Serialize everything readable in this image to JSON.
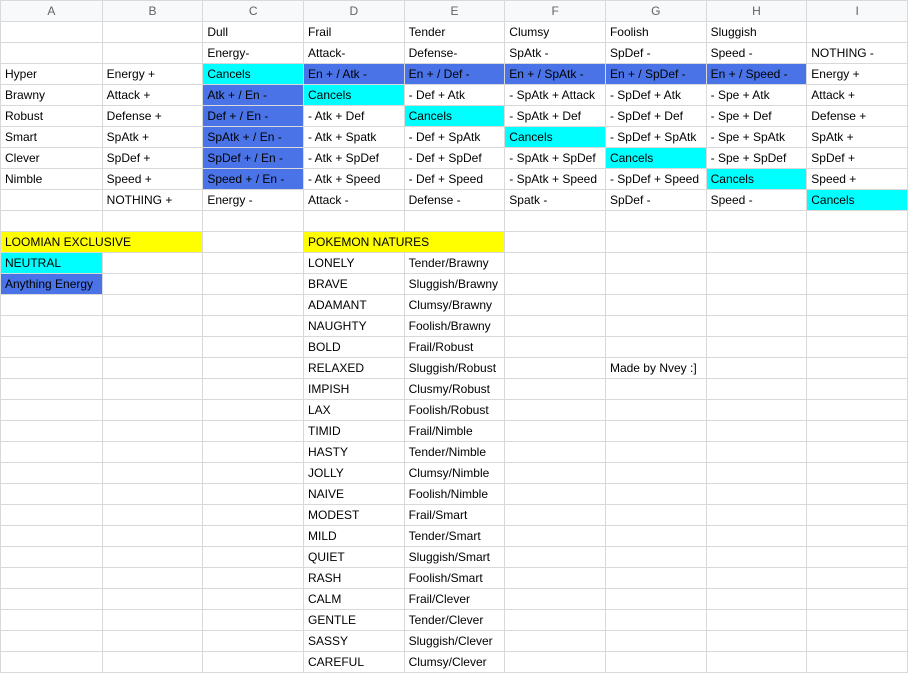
{
  "cols": [
    "A",
    "B",
    "C",
    "D",
    "E",
    "F",
    "G",
    "H",
    "I"
  ],
  "rows": [
    [
      {
        "t": ""
      },
      {
        "t": ""
      },
      {
        "t": "Dull"
      },
      {
        "t": "Frail"
      },
      {
        "t": "Tender"
      },
      {
        "t": "Clumsy"
      },
      {
        "t": "Foolish"
      },
      {
        "t": "Sluggish"
      },
      {
        "t": ""
      }
    ],
    [
      {
        "t": ""
      },
      {
        "t": ""
      },
      {
        "t": "Energy-"
      },
      {
        "t": "Attack-"
      },
      {
        "t": "Defense-"
      },
      {
        "t": "SpAtk -"
      },
      {
        "t": "SpDef -"
      },
      {
        "t": "Speed -"
      },
      {
        "t": "NOTHING -"
      }
    ],
    [
      {
        "t": "Hyper"
      },
      {
        "t": "Energy +"
      },
      {
        "t": "Cancels",
        "c": "cyan"
      },
      {
        "t": "En + / Atk -",
        "c": "blue"
      },
      {
        "t": "En + / Def -",
        "c": "blue"
      },
      {
        "t": "En + / SpAtk -",
        "c": "blue"
      },
      {
        "t": "En + / SpDef -",
        "c": "blue"
      },
      {
        "t": "En + / Speed -",
        "c": "blue"
      },
      {
        "t": "Energy +"
      }
    ],
    [
      {
        "t": "Brawny"
      },
      {
        "t": "Attack +"
      },
      {
        "t": "Atk + / En -",
        "c": "blue"
      },
      {
        "t": "Cancels",
        "c": "cyan"
      },
      {
        "t": "- Def + Atk"
      },
      {
        "t": "- SpAtk + Attack"
      },
      {
        "t": "- SpDef + Atk"
      },
      {
        "t": "- Spe + Atk"
      },
      {
        "t": "Attack +"
      }
    ],
    [
      {
        "t": "Robust"
      },
      {
        "t": "Defense +"
      },
      {
        "t": "Def + / En -",
        "c": "blue"
      },
      {
        "t": "- Atk + Def"
      },
      {
        "t": "Cancels",
        "c": "cyan"
      },
      {
        "t": "- SpAtk + Def"
      },
      {
        "t": "- SpDef + Def"
      },
      {
        "t": "- Spe + Def"
      },
      {
        "t": "Defense +"
      }
    ],
    [
      {
        "t": "Smart"
      },
      {
        "t": "SpAtk +"
      },
      {
        "t": "SpAtk + / En -",
        "c": "blue"
      },
      {
        "t": "- Atk + Spatk"
      },
      {
        "t": "- Def + SpAtk"
      },
      {
        "t": "Cancels",
        "c": "cyan"
      },
      {
        "t": "- SpDef + SpAtk"
      },
      {
        "t": "- Spe + SpAtk"
      },
      {
        "t": "SpAtk +"
      }
    ],
    [
      {
        "t": "Clever"
      },
      {
        "t": "SpDef +"
      },
      {
        "t": "SpDef + / En -",
        "c": "blue"
      },
      {
        "t": "- Atk + SpDef"
      },
      {
        "t": "- Def + SpDef"
      },
      {
        "t": "- SpAtk + SpDef"
      },
      {
        "t": "Cancels",
        "c": "cyan"
      },
      {
        "t": "- Spe + SpDef"
      },
      {
        "t": "SpDef +"
      }
    ],
    [
      {
        "t": "Nimble"
      },
      {
        "t": "Speed +"
      },
      {
        "t": "Speed + / En -",
        "c": "blue"
      },
      {
        "t": "- Atk + Speed"
      },
      {
        "t": "- Def + Speed"
      },
      {
        "t": "- SpAtk + Speed"
      },
      {
        "t": "- SpDef + Speed"
      },
      {
        "t": "Cancels",
        "c": "cyan"
      },
      {
        "t": "Speed +"
      }
    ],
    [
      {
        "t": ""
      },
      {
        "t": "NOTHING +"
      },
      {
        "t": "Energy -"
      },
      {
        "t": "Attack -"
      },
      {
        "t": "Defense -"
      },
      {
        "t": "Spatk -"
      },
      {
        "t": "SpDef -"
      },
      {
        "t": "Speed -"
      },
      {
        "t": "Cancels",
        "c": "cyan"
      }
    ],
    [
      {
        "t": ""
      },
      {
        "t": ""
      },
      {
        "t": ""
      },
      {
        "t": ""
      },
      {
        "t": ""
      },
      {
        "t": ""
      },
      {
        "t": ""
      },
      {
        "t": ""
      },
      {
        "t": ""
      }
    ],
    [
      {
        "t": "LOOMIAN EXCLUSIVE",
        "c": "yellow",
        "span": 2
      },
      {
        "t": ""
      },
      {
        "t": "POKEMON NATURES",
        "c": "yellow",
        "span": 2
      },
      {
        "t": ""
      },
      {
        "t": ""
      },
      {
        "t": ""
      },
      {
        "t": ""
      }
    ],
    [
      {
        "t": "NEUTRAL",
        "c": "cyan"
      },
      {
        "t": ""
      },
      {
        "t": ""
      },
      {
        "t": "LONELY"
      },
      {
        "t": "Tender/Brawny"
      },
      {
        "t": ""
      },
      {
        "t": ""
      },
      {
        "t": ""
      },
      {
        "t": ""
      }
    ],
    [
      {
        "t": "Anything Energy",
        "c": "blue"
      },
      {
        "t": ""
      },
      {
        "t": ""
      },
      {
        "t": "BRAVE"
      },
      {
        "t": "Sluggish/Brawny"
      },
      {
        "t": ""
      },
      {
        "t": ""
      },
      {
        "t": ""
      },
      {
        "t": ""
      }
    ],
    [
      {
        "t": ""
      },
      {
        "t": ""
      },
      {
        "t": ""
      },
      {
        "t": "ADAMANT"
      },
      {
        "t": "Clumsy/Brawny"
      },
      {
        "t": ""
      },
      {
        "t": ""
      },
      {
        "t": ""
      },
      {
        "t": ""
      }
    ],
    [
      {
        "t": ""
      },
      {
        "t": ""
      },
      {
        "t": ""
      },
      {
        "t": "NAUGHTY"
      },
      {
        "t": "Foolish/Brawny"
      },
      {
        "t": ""
      },
      {
        "t": ""
      },
      {
        "t": ""
      },
      {
        "t": ""
      }
    ],
    [
      {
        "t": ""
      },
      {
        "t": ""
      },
      {
        "t": ""
      },
      {
        "t": "BOLD"
      },
      {
        "t": "Frail/Robust"
      },
      {
        "t": ""
      },
      {
        "t": ""
      },
      {
        "t": ""
      },
      {
        "t": ""
      }
    ],
    [
      {
        "t": ""
      },
      {
        "t": ""
      },
      {
        "t": ""
      },
      {
        "t": "RELAXED"
      },
      {
        "t": "Sluggish/Robust"
      },
      {
        "t": ""
      },
      {
        "t": "Made by Nvey :]"
      },
      {
        "t": ""
      },
      {
        "t": ""
      }
    ],
    [
      {
        "t": ""
      },
      {
        "t": ""
      },
      {
        "t": ""
      },
      {
        "t": "IMPISH"
      },
      {
        "t": "Clusmy/Robust"
      },
      {
        "t": ""
      },
      {
        "t": ""
      },
      {
        "t": ""
      },
      {
        "t": ""
      }
    ],
    [
      {
        "t": ""
      },
      {
        "t": ""
      },
      {
        "t": ""
      },
      {
        "t": "LAX"
      },
      {
        "t": "Foolish/Robust"
      },
      {
        "t": ""
      },
      {
        "t": ""
      },
      {
        "t": ""
      },
      {
        "t": ""
      }
    ],
    [
      {
        "t": ""
      },
      {
        "t": ""
      },
      {
        "t": ""
      },
      {
        "t": "TIMID"
      },
      {
        "t": "Frail/Nimble"
      },
      {
        "t": ""
      },
      {
        "t": ""
      },
      {
        "t": ""
      },
      {
        "t": ""
      }
    ],
    [
      {
        "t": ""
      },
      {
        "t": ""
      },
      {
        "t": ""
      },
      {
        "t": "HASTY"
      },
      {
        "t": "Tender/Nimble"
      },
      {
        "t": ""
      },
      {
        "t": ""
      },
      {
        "t": ""
      },
      {
        "t": ""
      }
    ],
    [
      {
        "t": ""
      },
      {
        "t": ""
      },
      {
        "t": ""
      },
      {
        "t": "JOLLY"
      },
      {
        "t": "Clumsy/Nimble"
      },
      {
        "t": ""
      },
      {
        "t": ""
      },
      {
        "t": ""
      },
      {
        "t": ""
      }
    ],
    [
      {
        "t": ""
      },
      {
        "t": ""
      },
      {
        "t": ""
      },
      {
        "t": "NAIVE"
      },
      {
        "t": "Foolish/Nimble"
      },
      {
        "t": ""
      },
      {
        "t": ""
      },
      {
        "t": ""
      },
      {
        "t": ""
      }
    ],
    [
      {
        "t": ""
      },
      {
        "t": ""
      },
      {
        "t": ""
      },
      {
        "t": "MODEST"
      },
      {
        "t": "Frail/Smart"
      },
      {
        "t": ""
      },
      {
        "t": ""
      },
      {
        "t": ""
      },
      {
        "t": ""
      }
    ],
    [
      {
        "t": ""
      },
      {
        "t": ""
      },
      {
        "t": ""
      },
      {
        "t": "MILD"
      },
      {
        "t": "Tender/Smart"
      },
      {
        "t": ""
      },
      {
        "t": ""
      },
      {
        "t": ""
      },
      {
        "t": ""
      }
    ],
    [
      {
        "t": ""
      },
      {
        "t": ""
      },
      {
        "t": ""
      },
      {
        "t": "QUIET"
      },
      {
        "t": "Sluggish/Smart"
      },
      {
        "t": ""
      },
      {
        "t": ""
      },
      {
        "t": ""
      },
      {
        "t": ""
      }
    ],
    [
      {
        "t": ""
      },
      {
        "t": ""
      },
      {
        "t": ""
      },
      {
        "t": "RASH"
      },
      {
        "t": "Foolish/Smart"
      },
      {
        "t": ""
      },
      {
        "t": ""
      },
      {
        "t": ""
      },
      {
        "t": ""
      }
    ],
    [
      {
        "t": ""
      },
      {
        "t": ""
      },
      {
        "t": ""
      },
      {
        "t": "CALM"
      },
      {
        "t": "Frail/Clever"
      },
      {
        "t": ""
      },
      {
        "t": ""
      },
      {
        "t": ""
      },
      {
        "t": ""
      }
    ],
    [
      {
        "t": ""
      },
      {
        "t": ""
      },
      {
        "t": ""
      },
      {
        "t": "GENTLE"
      },
      {
        "t": "Tender/Clever"
      },
      {
        "t": ""
      },
      {
        "t": ""
      },
      {
        "t": ""
      },
      {
        "t": ""
      }
    ],
    [
      {
        "t": ""
      },
      {
        "t": ""
      },
      {
        "t": ""
      },
      {
        "t": "SASSY"
      },
      {
        "t": "Sluggish/Clever"
      },
      {
        "t": ""
      },
      {
        "t": ""
      },
      {
        "t": ""
      },
      {
        "t": ""
      }
    ],
    [
      {
        "t": ""
      },
      {
        "t": ""
      },
      {
        "t": ""
      },
      {
        "t": "CAREFUL"
      },
      {
        "t": "Clumsy/Clever"
      },
      {
        "t": ""
      },
      {
        "t": ""
      },
      {
        "t": ""
      },
      {
        "t": ""
      }
    ]
  ]
}
